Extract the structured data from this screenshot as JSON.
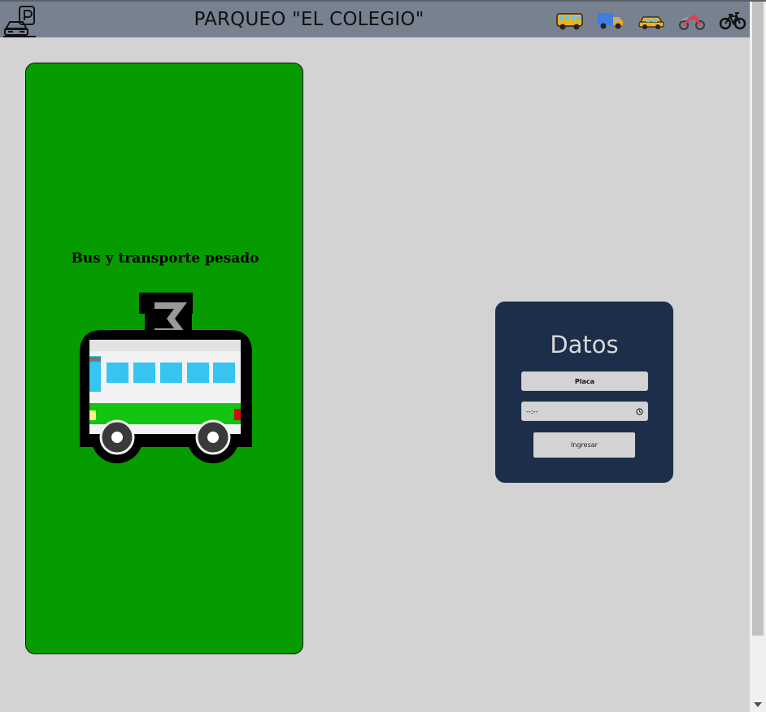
{
  "header": {
    "title": "PARQUEO \"EL COLEGIO\"",
    "logo_icon": "parking-car-icon",
    "vehicle_icons": [
      "bus-icon",
      "truck-icon",
      "car-icon",
      "motorcycle-icon",
      "bicycle-icon"
    ]
  },
  "card": {
    "label": "Bus y transporte pesado",
    "icon": "trolleybus-icon",
    "color": "#069c00"
  },
  "form": {
    "title": "Datos",
    "placa_placeholder": "Placa",
    "time_value": "--:--",
    "submit_label": "Ingresar",
    "color": "#1c2e4a"
  }
}
